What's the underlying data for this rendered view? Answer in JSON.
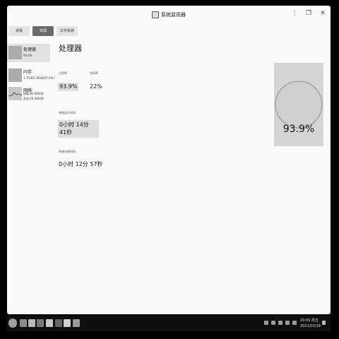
{
  "window": {
    "title": "系统监视器",
    "controls": {
      "menu": "⋮",
      "restore": "❐",
      "close": "✕"
    }
  },
  "tabs": [
    {
      "label": "进程"
    },
    {
      "label": "资源"
    },
    {
      "label": "文件系统"
    }
  ],
  "active_tab": "资源",
  "sidebar": {
    "items": [
      {
        "title": "处理器",
        "sub1": "93.9%",
        "sub2": ""
      },
      {
        "title": "内存",
        "sub1": "1.7GiB/1.9GiB(87.0%)",
        "sub2": ""
      },
      {
        "title": "网络",
        "sub1": "接收:82.0KB/秒",
        "sub2": "发送:16.3KB/秒"
      }
    ]
  },
  "main": {
    "title": "处理器",
    "usage_label": "占用率",
    "usage_value": "93.9%",
    "idle_label": "空闲率",
    "idle_value": "22%",
    "uptime_label": "系统运行时间",
    "uptime_value": "0小时 14分 41秒",
    "idle_time_label": "系统空闲时间",
    "idle_time_value": "0小时 12分 57秒"
  },
  "gauge": {
    "value_text": "93.9%",
    "fraction": 0.939
  },
  "taskbar": {
    "time": "20:05 周五",
    "date": "2021/03/19"
  }
}
